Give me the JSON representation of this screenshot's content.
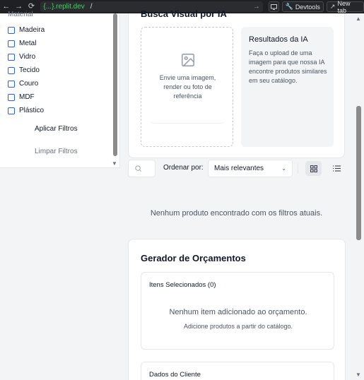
{
  "browser": {
    "back": "←",
    "forward": "→",
    "reload": "⟳",
    "url_badge": "{...}.replit.dev",
    "url_path": "/",
    "go": "→",
    "devtools": "Devtools",
    "new_tab": "New tab"
  },
  "sidebar": {
    "heading": "Material",
    "materials": [
      "Madeira",
      "Metal",
      "Vidro",
      "Tecido",
      "Couro",
      "MDF",
      "Plástico"
    ],
    "apply": "Aplicar Filtros",
    "clear": "Limpar Filtros"
  },
  "visual_search": {
    "title": "Busca Visual por IA",
    "upload_text": "Envie uma imagem, render ou foto de referência",
    "results_title": "Resultados da IA",
    "results_desc": "Faça o upload de uma imagem para que nossa IA encontre produtos similares em seu catálogo."
  },
  "toolbar": {
    "sort_label": "Ordenar por:",
    "sort_value": "Mais relevantes"
  },
  "products": {
    "empty": "Nenhum produto encontrado com os filtros atuais."
  },
  "quote": {
    "title": "Gerador de Orçamentos",
    "items_heading": "Itens Selecionados (0)",
    "items_empty": "Nenhum item adicionado ao orçamento.",
    "items_hint": "Adicione produtos a partir do catálogo.",
    "client_heading": "Dados do Cliente"
  },
  "colors": {
    "accent": "#2563eb",
    "badge_green": "#3fd163"
  }
}
